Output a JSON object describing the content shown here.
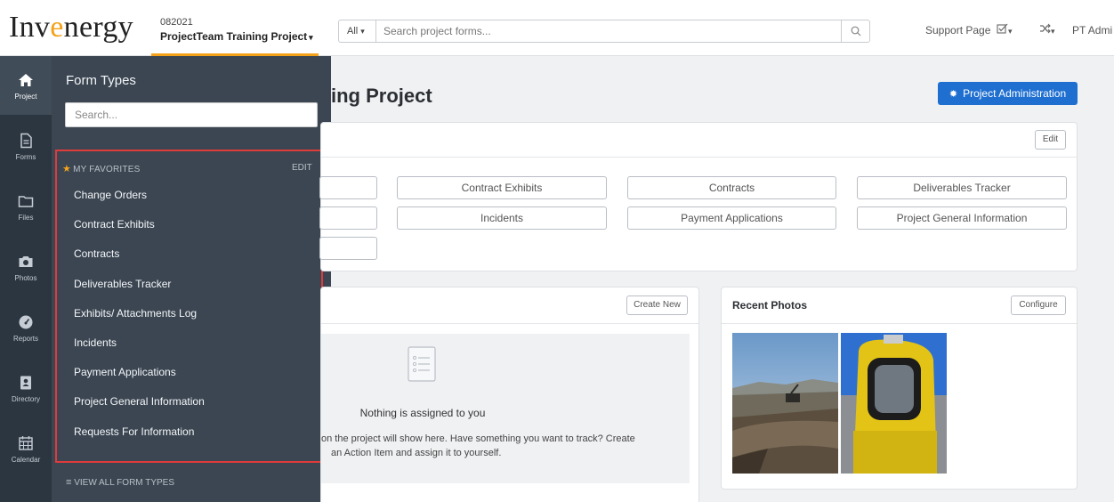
{
  "header": {
    "logo_prefix": "Inv",
    "logo_accent": "e",
    "logo_suffix": "nergy",
    "project_id": "082021",
    "project_name": "ProjectTeam Training Project",
    "search_scope": "All",
    "search_placeholder": "Search project forms...",
    "support_label": "Support Page",
    "user_label": "PT Admi"
  },
  "rail": {
    "items": [
      {
        "label": "Project",
        "icon": "home-icon"
      },
      {
        "label": "Forms",
        "icon": "document-icon"
      },
      {
        "label": "Files",
        "icon": "folder-icon"
      },
      {
        "label": "Photos",
        "icon": "camera-icon"
      },
      {
        "label": "Reports",
        "icon": "dashboard-icon"
      },
      {
        "label": "Directory",
        "icon": "contact-icon"
      },
      {
        "label": "Calendar",
        "icon": "calendar-icon"
      }
    ]
  },
  "flyout": {
    "title": "Form Types",
    "search_placeholder": "Search...",
    "favorites_label": "MY FAVORITES",
    "edit_label": "EDIT",
    "favorites": [
      "Change Orders",
      "Contract Exhibits",
      "Contracts",
      "Deliverables Tracker",
      "Exhibits/ Attachments Log",
      "Incidents",
      "Payment Applications",
      "Project General Information",
      "Requests For Information"
    ],
    "view_all_label": "VIEW ALL FORM TYPES"
  },
  "main": {
    "title_visible": "ing Project",
    "admin_button": "Project Administration",
    "edit_button": "Edit",
    "form_buttons": [
      "Contract Exhibits",
      "Contracts",
      "Deliverables Tracker",
      "Incidents",
      "Payment Applications",
      "Project General Information"
    ],
    "create_new": "Create New",
    "empty_title": "Nothing is assigned to you",
    "empty_desc_1": "on the project will show here. Have something you want to track? Create",
    "empty_desc_2": "an Action Item and assign it to yourself.",
    "photos_title": "Recent Photos",
    "configure_button": "Configure"
  },
  "colors": {
    "accent": "#f3a21a",
    "primary": "#1f6fd1",
    "rail": "#2b3641",
    "flyout": "#3b4652",
    "highlight_box": "#e03b3b"
  }
}
